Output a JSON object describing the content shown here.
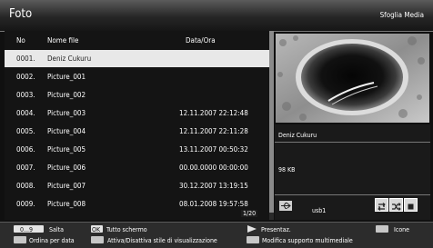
{
  "header": {
    "title": "Foto",
    "right_label": "Sfoglia Media"
  },
  "columns": {
    "no": "No",
    "name": "Nome file",
    "date": "Data/Ora"
  },
  "rows": [
    {
      "no": "0001.",
      "name": "Deniz Cukuru",
      "date": "",
      "selected": true
    },
    {
      "no": "0002.",
      "name": "Picture_001",
      "date": ""
    },
    {
      "no": "0003.",
      "name": "Picture_002",
      "date": ""
    },
    {
      "no": "0004.",
      "name": "Picture_003",
      "date": "12.11.2007 22:12:48"
    },
    {
      "no": "0005.",
      "name": "Picture_004",
      "date": "12.11.2007 22:11:28"
    },
    {
      "no": "0006.",
      "name": "Picture_005",
      "date": "13.11.2007 00:50:32"
    },
    {
      "no": "0007.",
      "name": "Picture_006",
      "date": "00.00.0000 00:00:00"
    },
    {
      "no": "0008.",
      "name": "Picture_007",
      "date": "30.12.2007 13:19:15"
    },
    {
      "no": "0009.",
      "name": "Picture_008",
      "date": "08.01.2008 19:57:58"
    }
  ],
  "page_indicator": "1/20",
  "preview_info": {
    "name": "Deniz Cukuru",
    "size": "98 KB",
    "device": "usb1"
  },
  "footer": {
    "key_0_9": "0...9",
    "key_ok": "OK",
    "salta": "Salta",
    "tutto_schermo": "Tutto schermo",
    "presentaz": "Presentaz.",
    "icone": "Icone",
    "ordina": "Ordina per data",
    "attiva": "Attiva/Disattiva stile di visualizzazione",
    "modifica": "Modifica supporto multimediale"
  },
  "colors": {
    "red_key": "#c43a2e",
    "green_key": "#4a9a3a",
    "yellow_key": "#d8c23a",
    "blue_key": "#3a63b8",
    "selection": "#e8e8e8"
  }
}
